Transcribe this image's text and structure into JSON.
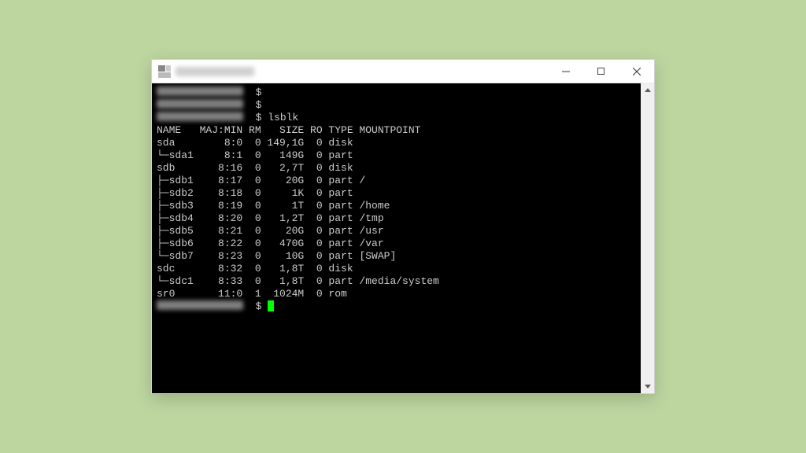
{
  "window": {
    "min": "—",
    "max": "□",
    "close": "×"
  },
  "prompt": {
    "symbol": "$",
    "cmd": "lsblk"
  },
  "header": {
    "name": "NAME",
    "majmin": "MAJ:MIN",
    "rm": "RM",
    "size": "SIZE",
    "ro": "RO",
    "type": "TYPE",
    "mount": "MOUNTPOINT"
  },
  "rows": [
    {
      "name": "sda",
      "tree": "",
      "maj": "8:0",
      "rm": "0",
      "size": "149,1G",
      "ro": "0",
      "type": "disk",
      "mount": ""
    },
    {
      "name": "sda1",
      "tree": "└─",
      "maj": "8:1",
      "rm": "0",
      "size": "149G",
      "ro": "0",
      "type": "part",
      "mount": ""
    },
    {
      "name": "sdb",
      "tree": "",
      "maj": "8:16",
      "rm": "0",
      "size": "2,7T",
      "ro": "0",
      "type": "disk",
      "mount": ""
    },
    {
      "name": "sdb1",
      "tree": "├─",
      "maj": "8:17",
      "rm": "0",
      "size": "20G",
      "ro": "0",
      "type": "part",
      "mount": "/"
    },
    {
      "name": "sdb2",
      "tree": "├─",
      "maj": "8:18",
      "rm": "0",
      "size": "1K",
      "ro": "0",
      "type": "part",
      "mount": ""
    },
    {
      "name": "sdb3",
      "tree": "├─",
      "maj": "8:19",
      "rm": "0",
      "size": "1T",
      "ro": "0",
      "type": "part",
      "mount": "/home"
    },
    {
      "name": "sdb4",
      "tree": "├─",
      "maj": "8:20",
      "rm": "0",
      "size": "1,2T",
      "ro": "0",
      "type": "part",
      "mount": "/tmp"
    },
    {
      "name": "sdb5",
      "tree": "├─",
      "maj": "8:21",
      "rm": "0",
      "size": "20G",
      "ro": "0",
      "type": "part",
      "mount": "/usr"
    },
    {
      "name": "sdb6",
      "tree": "├─",
      "maj": "8:22",
      "rm": "0",
      "size": "470G",
      "ro": "0",
      "type": "part",
      "mount": "/var"
    },
    {
      "name": "sdb7",
      "tree": "└─",
      "maj": "8:23",
      "rm": "0",
      "size": "10G",
      "ro": "0",
      "type": "part",
      "mount": "[SWAP]"
    },
    {
      "name": "sdc",
      "tree": "",
      "maj": "8:32",
      "rm": "0",
      "size": "1,8T",
      "ro": "0",
      "type": "disk",
      "mount": ""
    },
    {
      "name": "sdc1",
      "tree": "└─",
      "maj": "8:33",
      "rm": "0",
      "size": "1,8T",
      "ro": "0",
      "type": "part",
      "mount": "/media/system"
    },
    {
      "name": "sr0",
      "tree": "",
      "maj": "11:0",
      "rm": "1",
      "size": "1024M",
      "ro": "0",
      "type": "rom",
      "mount": ""
    }
  ]
}
